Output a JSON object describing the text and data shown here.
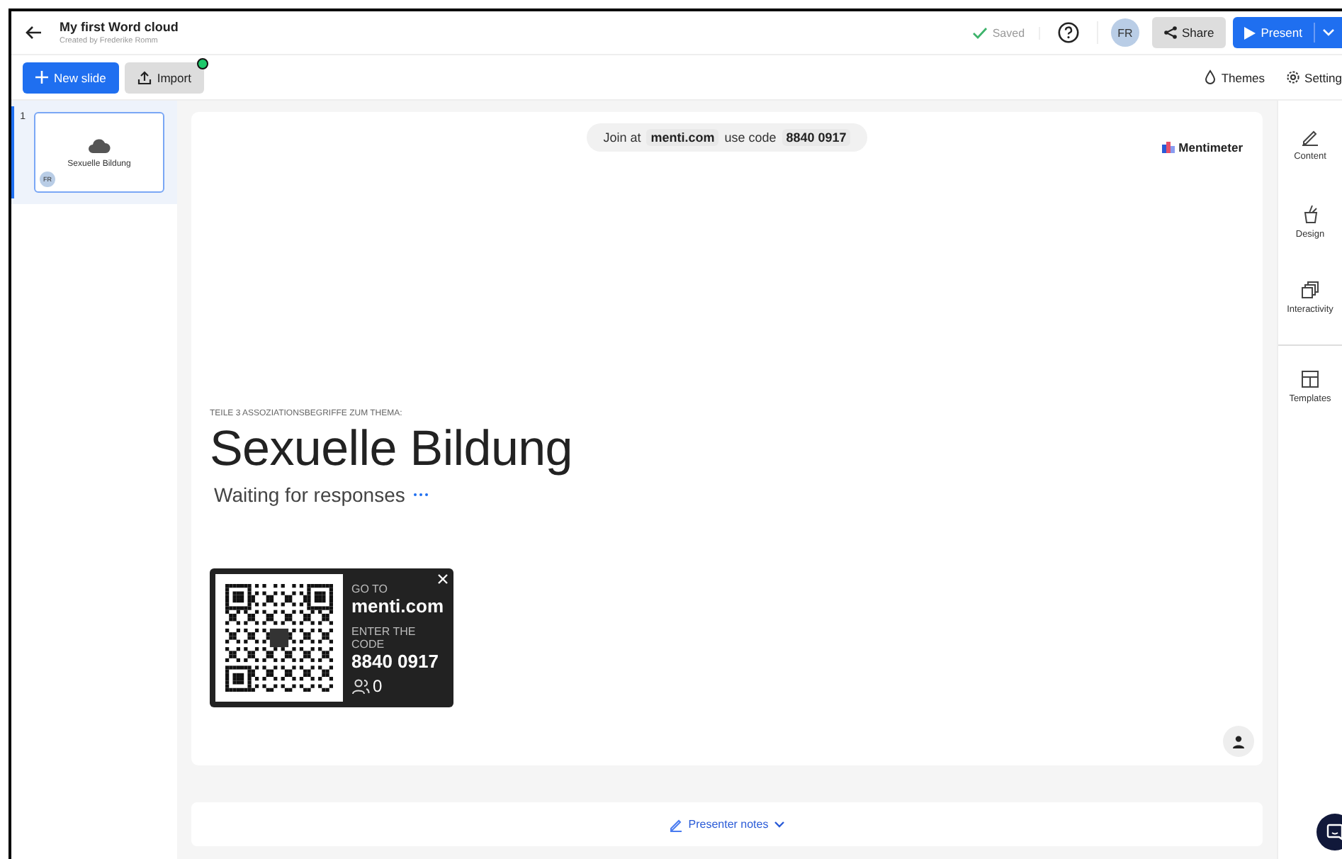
{
  "document": {
    "title": "My first Word cloud",
    "subtitle": "Created by Frederike Romm"
  },
  "header": {
    "saved": "Saved",
    "avatar": "FR",
    "share": "Share",
    "present": "Present"
  },
  "toolbar": {
    "new_slide": "New slide",
    "import": "Import",
    "import_badge": true,
    "themes": "Themes",
    "settings": "Setting"
  },
  "slides": [
    {
      "number": "1",
      "title": "Sexuelle Bildung",
      "avatar": "FR",
      "selected": true
    }
  ],
  "rail": [
    {
      "label": "Content"
    },
    {
      "label": "Design"
    },
    {
      "label": "Interactivity"
    },
    {
      "label": "Templates"
    }
  ],
  "slide": {
    "join_prefix": "Join at",
    "join_url": "menti.com",
    "join_mid": "use code",
    "join_code": "8840 0917",
    "brand": "Mentimeter",
    "eyebrow": "TEILE 3 ASSOZIATIONSBEGRIFFE ZUM THEMA:",
    "heading": "Sexuelle Bildung",
    "status": "Waiting for responses",
    "qr": {
      "goto_label": "GO TO",
      "url": "menti.com",
      "code_label": "ENTER THE CODE",
      "code": "8840 0917",
      "participants": "0"
    }
  },
  "notes": {
    "label": "Presenter notes"
  }
}
